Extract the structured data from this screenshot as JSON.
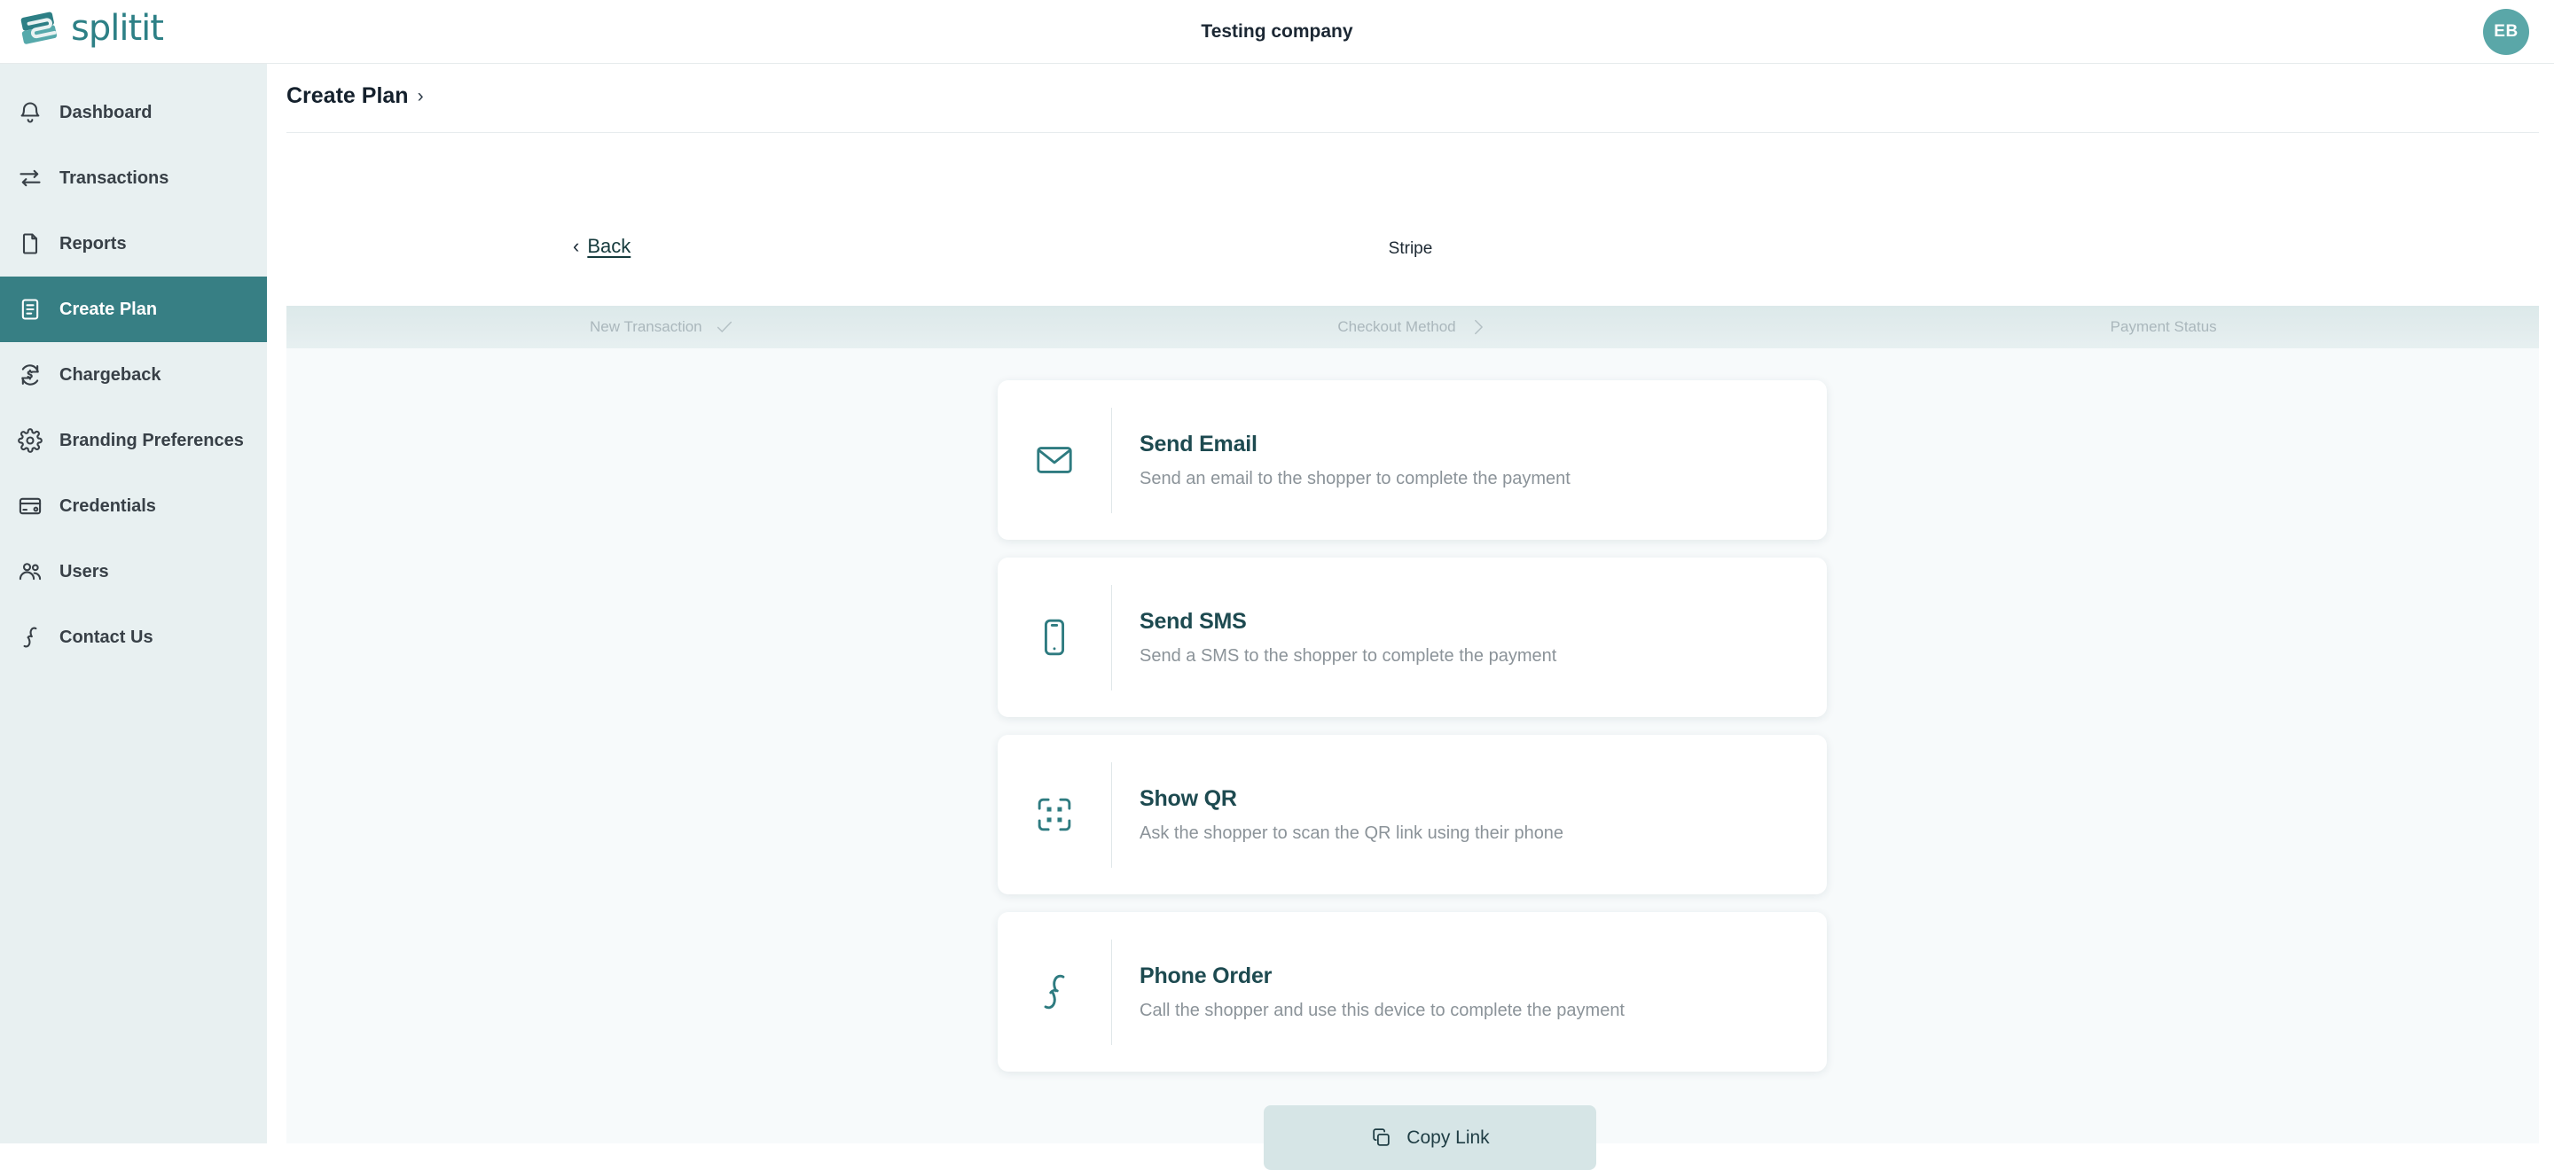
{
  "brand": {
    "logo_text": "splitit",
    "accent_teal": "#2d8086",
    "active_nav_teal": "#377f84",
    "sidebar_bg": "#e8f0f1",
    "content_bg": "#f7fafb",
    "avatar_bg": "#5aa7a8"
  },
  "header": {
    "company_title": "Testing company",
    "avatar_initials": "EB"
  },
  "sidebar": {
    "items": [
      {
        "label": "Dashboard",
        "icon": "bell-icon",
        "active": false
      },
      {
        "label": "Transactions",
        "icon": "transfer-icon",
        "active": false
      },
      {
        "label": "Reports",
        "icon": "document-icon",
        "active": false
      },
      {
        "label": "Create Plan",
        "icon": "plan-list-icon",
        "active": true
      },
      {
        "label": "Chargeback",
        "icon": "refund-icon",
        "active": false
      },
      {
        "label": "Branding Preferences",
        "icon": "gear-icon",
        "active": false
      },
      {
        "label": "Credentials",
        "icon": "card-icon",
        "active": false
      },
      {
        "label": "Users",
        "icon": "users-icon",
        "active": false
      },
      {
        "label": "Contact Us",
        "icon": "phone-icon",
        "active": false
      }
    ]
  },
  "main": {
    "breadcrumb": "Create Plan",
    "breadcrumb_chevron": "›",
    "back_label": "Back",
    "back_chevron": "‹",
    "gateway_label": "Stripe"
  },
  "stepper": {
    "steps": [
      {
        "label": "New Transaction",
        "mark": "check-icon",
        "state": "completed"
      },
      {
        "label": "Checkout Method",
        "mark": "chevron-right-icon",
        "state": "current"
      },
      {
        "label": "Payment Status",
        "mark": "none",
        "state": "upcoming"
      }
    ]
  },
  "options": [
    {
      "title": "Send Email",
      "description": "Send an email to the shopper to complete the payment",
      "icon": "envelope-icon"
    },
    {
      "title": "Send SMS",
      "description": "Send a SMS to the shopper to complete the payment",
      "icon": "mobile-phone-icon"
    },
    {
      "title": "Show QR",
      "description": "Ask the shopper to scan the QR link using their phone",
      "icon": "qr-scan-icon"
    },
    {
      "title": "Phone Order",
      "description": "Call the shopper and use this device to complete the payment",
      "icon": "phone-handset-icon"
    }
  ],
  "copy_link": {
    "label": "Copy Link",
    "icon": "copy-icon"
  }
}
